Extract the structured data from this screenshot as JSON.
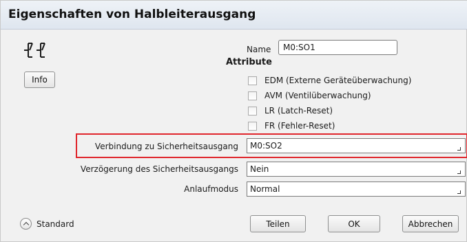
{
  "window": {
    "title": "Eigenschaften von Halbleiterausgang"
  },
  "left_panel": {
    "symbol_icon": "contact-pair-icon",
    "info_label": "Info"
  },
  "name": {
    "label": "Name",
    "value": "M0:SO1"
  },
  "attributes": {
    "heading": "Attribute",
    "items": [
      {
        "label": "EDM (Externe Geräteüberwachung)",
        "checked": false
      },
      {
        "label": "AVM (Ventilüberwachung)",
        "checked": false
      },
      {
        "label": "LR (Latch-Reset)",
        "checked": false
      },
      {
        "label": "FR (Fehler-Reset)",
        "checked": false
      }
    ]
  },
  "fields": {
    "connection": {
      "label": "Verbindung zu Sicherheitsausgang",
      "value": "M0:SO2"
    },
    "delay": {
      "label": "Verzögerung des Sicherheitsausgangs",
      "value": "Nein"
    },
    "startup": {
      "label": "Anlaufmodus",
      "value": "Normal"
    }
  },
  "footer": {
    "standard_label": "Standard",
    "share_label": "Teilen",
    "ok_label": "OK",
    "cancel_label": "Abbrechen"
  },
  "colors": {
    "highlight": "#e0252b",
    "title_bar": "#dfe6ef",
    "dialog_bg": "#f1f1f1"
  }
}
